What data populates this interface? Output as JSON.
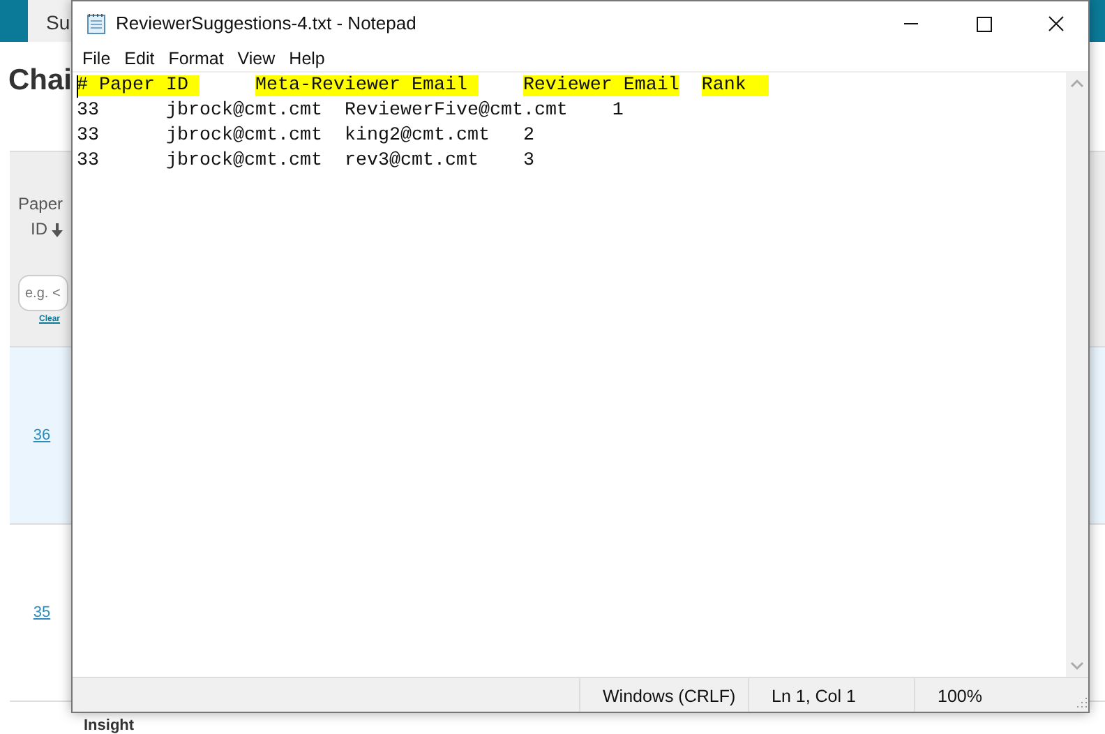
{
  "background_page": {
    "tab": "Su",
    "heading": "Chai",
    "table": {
      "header": "Paper ID",
      "filter_placeholder": "e.g. <",
      "clear_link": "Clear",
      "rows": [
        {
          "paper_id": "36",
          "highlighted": true
        },
        {
          "paper_id": "35",
          "highlighted": false
        }
      ],
      "next_row_label": "Insight"
    }
  },
  "notepad": {
    "title": "ReviewerSuggestions-4.txt - Notepad",
    "menu": [
      "File",
      "Edit",
      "Format",
      "View",
      "Help"
    ],
    "lines": [
      {
        "segments": [
          {
            "text": "# Paper ID",
            "highlighted": true,
            "kind": "tabbed"
          },
          {
            "text": "Meta-Reviewer Email",
            "highlighted": true,
            "kind": "tabbed"
          },
          {
            "text": "Reviewer Email",
            "highlighted": true,
            "kind": "spaced"
          },
          {
            "text": "Rank",
            "highlighted": true,
            "kind": "padded"
          }
        ]
      },
      {
        "segments": [
          {
            "text": "33\tjbrock@cmt.cmt  ReviewerFive@cmt.cmt\t1",
            "highlighted": false
          }
        ]
      },
      {
        "segments": [
          {
            "text": "33\tjbrock@cmt.cmt  king2@cmt.cmt\t2",
            "highlighted": false
          }
        ]
      },
      {
        "segments": [
          {
            "text": "33\tjbrock@cmt.cmt  rev3@cmt.cmt\t3",
            "highlighted": false
          }
        ]
      }
    ],
    "status_bar": [
      "Windows (CRLF)",
      "Ln 1, Col 1",
      "100%"
    ]
  }
}
